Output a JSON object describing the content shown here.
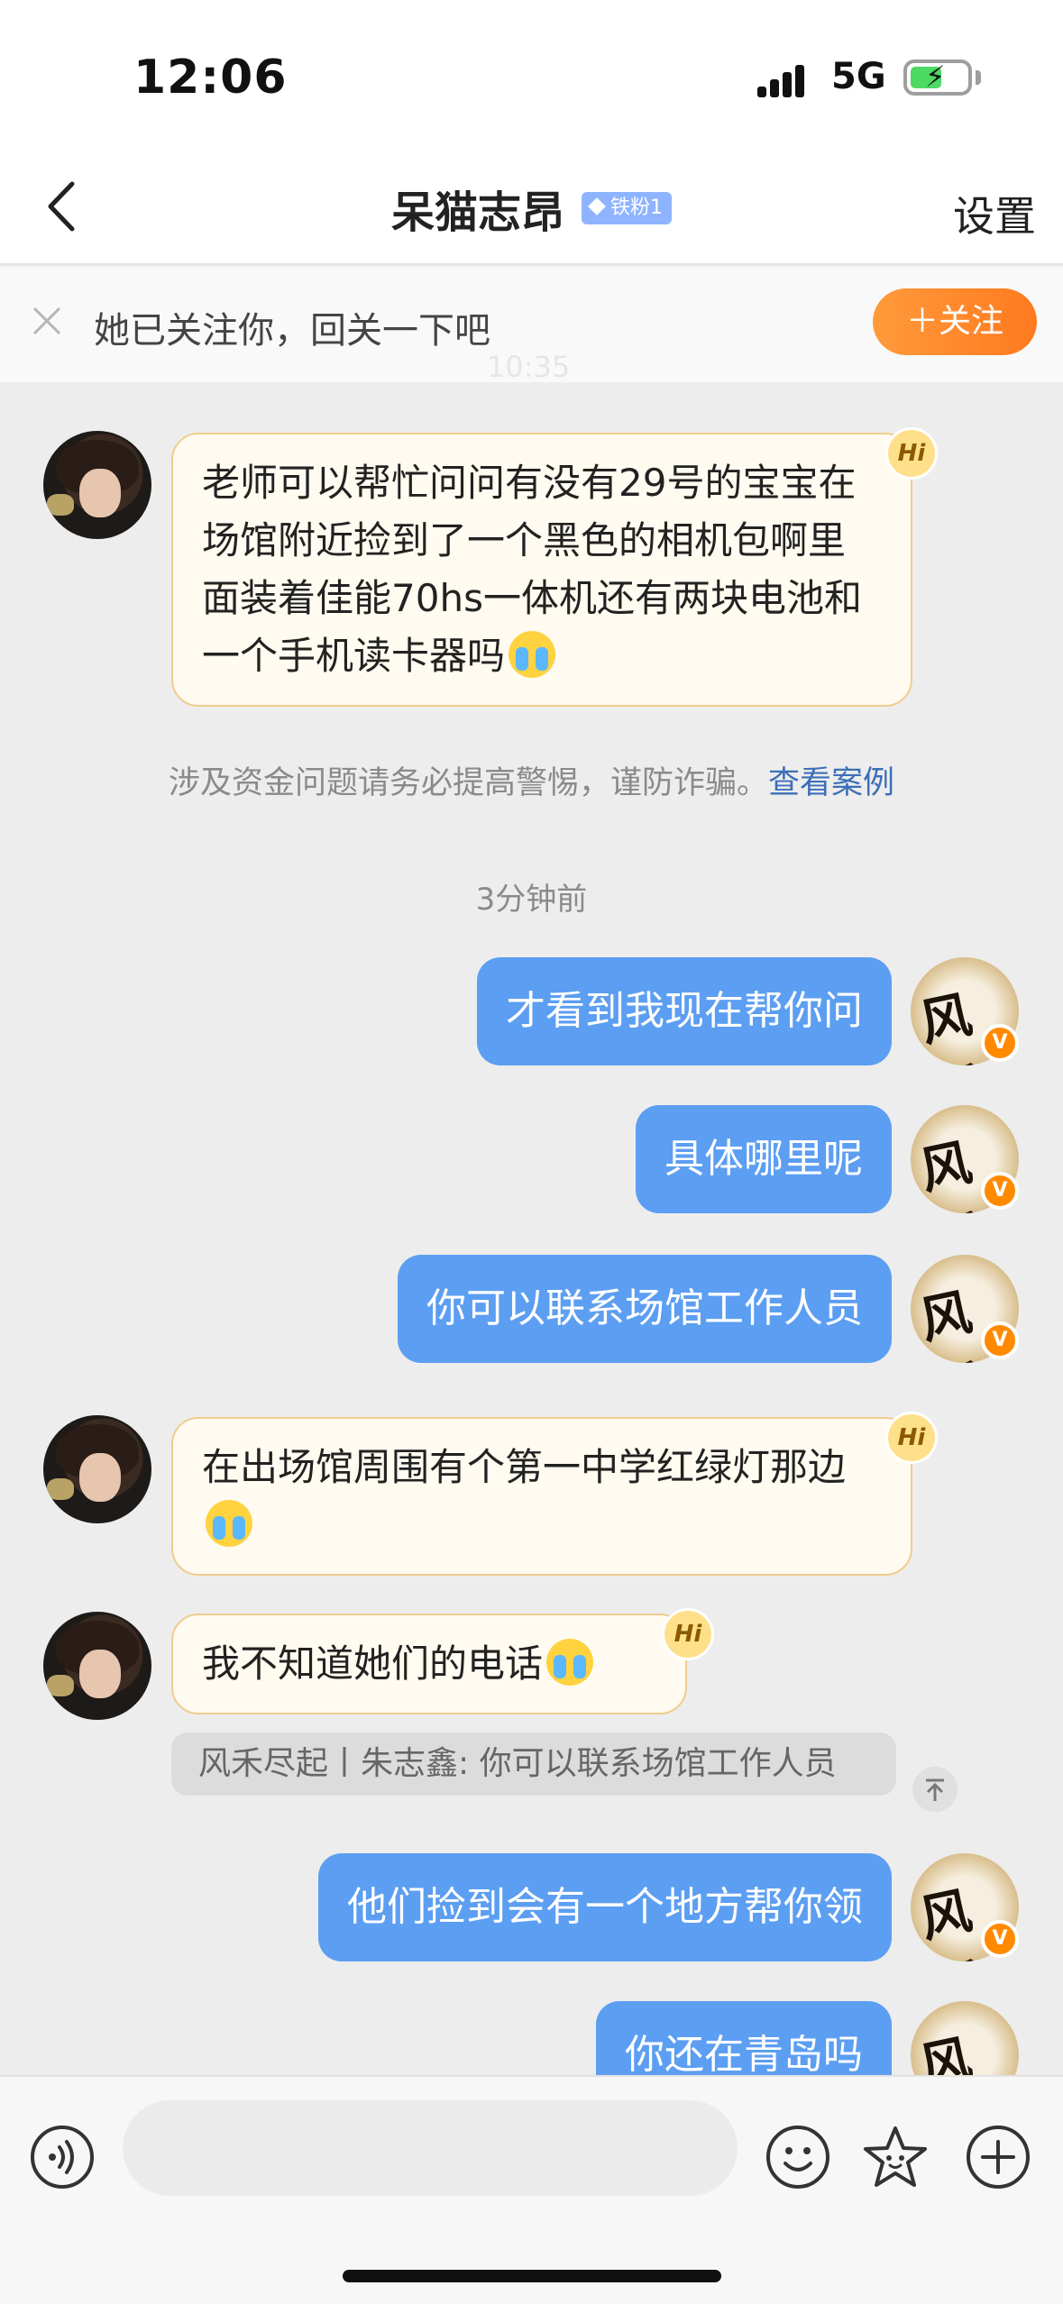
{
  "status_bar": {
    "time": "12:06",
    "network": "5G",
    "battery_state": "charging"
  },
  "header": {
    "back_icon": "chevron-left-icon",
    "title": "呆猫志昂",
    "fan_badge": "铁粉1",
    "settings_label": "设置"
  },
  "follow_banner": {
    "text": "她已关注你，回关一下吧",
    "faded_text": "10:35",
    "button_label": "＋关注"
  },
  "messages": [
    {
      "side": "left",
      "text": "老师可以帮忙问问有没有29号的宝宝在场馆附近捡到了一个黑色的相机包啊里面装着佳能70hs一体机还有两块电池和一个手机读卡器吗",
      "emoji": "loudly-crying-face"
    },
    {
      "side": "right",
      "text": "才看到我现在帮你问"
    },
    {
      "side": "right",
      "text": "具体哪里呢"
    },
    {
      "side": "right",
      "text": "你可以联系场馆工作人员"
    },
    {
      "side": "left",
      "text": "在出场馆周围有个第一中学红绿灯那边",
      "emoji": "loudly-crying-face"
    },
    {
      "side": "left",
      "text": "我不知道她们的电话",
      "emoji": "loudly-crying-face"
    },
    {
      "side": "right",
      "text": "他们捡到会有一个地方帮你领"
    },
    {
      "side": "right",
      "text": "你还在青岛吗"
    }
  ],
  "hi_badge": "Hi",
  "warning": {
    "text": "涉及资金问题请务必提高警惕，谨防诈骗。",
    "link": "查看案例"
  },
  "timestamp": "3分钟前",
  "quote": {
    "text": "风禾尽起丨朱志鑫: 你可以联系场馆工作人员"
  },
  "input_bar": {
    "voice_icon": "voice-icon",
    "emoji_icon": "smiley-icon",
    "sticker_icon": "star-face-icon",
    "plus_icon": "plus-circle-icon",
    "input_value": ""
  },
  "colors": {
    "sent_bubble": "#5c9ef2",
    "received_bubble": "#fffbf0",
    "received_border": "#f0cc8f",
    "follow_button": "#ff8a2a",
    "link": "#3d6fb8"
  }
}
